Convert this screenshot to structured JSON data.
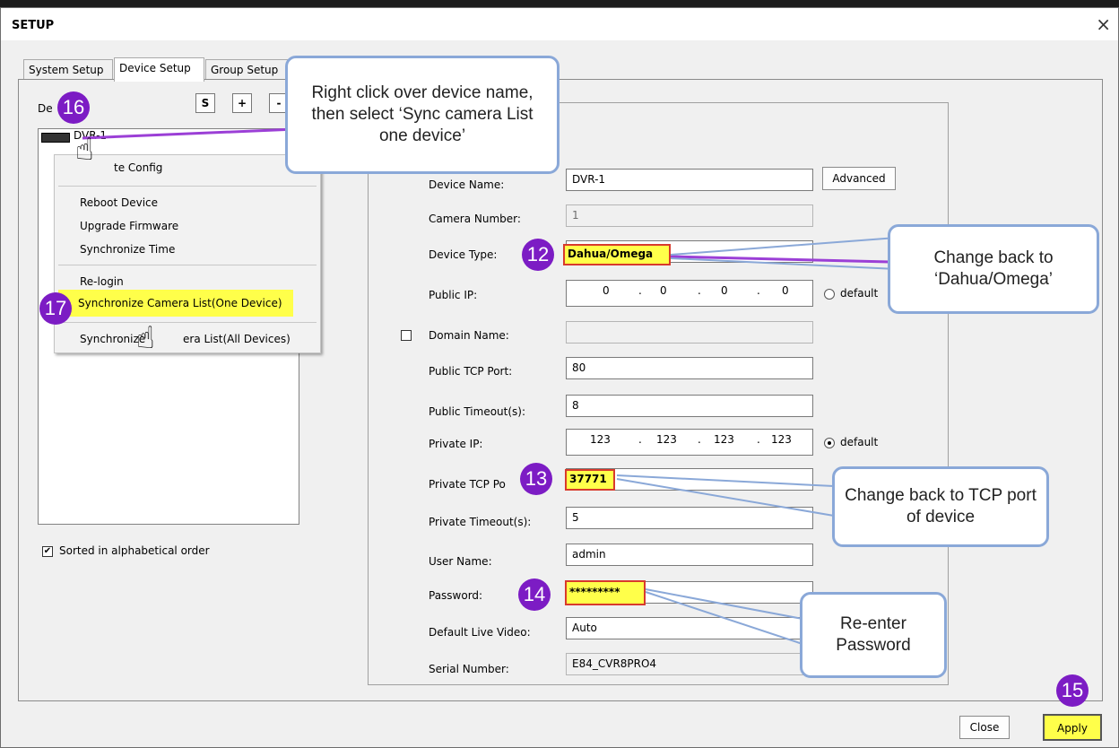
{
  "window": {
    "title": "SETUP",
    "close_glyph": "×"
  },
  "tabs": [
    {
      "label": "System Setup"
    },
    {
      "label": "Device Setup"
    },
    {
      "label": "Group Setup"
    }
  ],
  "left": {
    "label_prefix": "De",
    "toolbar": {
      "s_label": "S",
      "add_label": "+",
      "remove_label": "-"
    },
    "tree": {
      "device_label": "DVR-1",
      "device_icon": "dvr-device-icon"
    },
    "sort_checkbox": {
      "label": "Sorted in alphabetical order",
      "checked": true,
      "mark": "✔"
    }
  },
  "context_menu": {
    "items": [
      {
        "label": "te Config"
      },
      {
        "label": "Reboot Device"
      },
      {
        "label": "Upgrade Firmware"
      },
      {
        "label": "Synchronize Time"
      },
      {
        "label": "Re-login"
      },
      {
        "label": "Synchronize Camera List(One Device)"
      },
      {
        "label_a": "Synchronize",
        "label_b": "era List(All Devices)"
      }
    ]
  },
  "form": {
    "device_name": {
      "label": "Device Name:",
      "value": "DVR-1"
    },
    "advanced_label": "Advanced",
    "camera_number": {
      "label": "Camera Number:",
      "value": "1"
    },
    "device_type": {
      "label": "Device Type:",
      "value": "Dahua/Omega"
    },
    "public_ip": {
      "label": "Public IP:",
      "octets": [
        "0",
        "0",
        "0",
        "0"
      ],
      "dot": ".",
      "default_label": "default",
      "default_selected": false
    },
    "domain_name": {
      "label": "Domain Name:",
      "value": "",
      "checked": false
    },
    "public_tcp_port": {
      "label": "Public TCP Port:",
      "value": "80"
    },
    "public_timeout": {
      "label": "Public Timeout(s):",
      "value": "8"
    },
    "private_ip": {
      "label": "Private IP:",
      "octets": [
        "123",
        "123",
        "123",
        "123"
      ],
      "dot": ".",
      "default_label": "default",
      "default_selected": true
    },
    "private_tcp_port": {
      "label": "Private TCP Po",
      "value": "37771"
    },
    "private_timeout": {
      "label": "Private Timeout(s):",
      "value": "5"
    },
    "user_name": {
      "label": "User Name:",
      "value": "admin"
    },
    "password": {
      "label": "Password:",
      "value": "*********"
    },
    "default_live_video": {
      "label": "Default Live Video:",
      "value": "Auto"
    },
    "serial_number": {
      "label": "Serial Number:",
      "value": "E84_CVR8PRO4"
    }
  },
  "buttons": {
    "close_label": "Close",
    "apply_label": "Apply"
  },
  "annotations": {
    "badges": [
      "16",
      "17",
      "12",
      "13",
      "14",
      "15"
    ],
    "callouts": {
      "sync": "Right click over device name, then select ‘Sync camera List one device’",
      "device_type": "Change back to ‘Dahua/Omega’",
      "tcp_port": "Change back to TCP port of device",
      "password": "Re-enter Password"
    },
    "hand_icon": "pointing-hand-cursor-icon"
  },
  "colors": {
    "highlight": "#ffff4a",
    "highlight_border": "#d83a2c",
    "badge": "#7c1cc4",
    "callout_border": "#8aa8d8"
  }
}
